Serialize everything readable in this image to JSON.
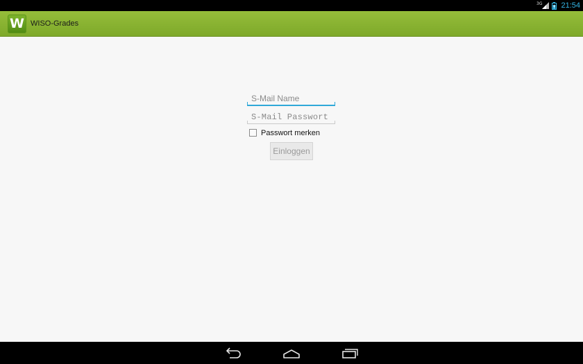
{
  "status_bar": {
    "network_label": "3G",
    "clock": "21:54",
    "accent_color": "#33b5e5"
  },
  "action_bar": {
    "icon_letter": "W",
    "title": "WISO-Grades",
    "color": "#8cb534"
  },
  "login_form": {
    "username": {
      "value": "",
      "placeholder": "S-Mail Name",
      "focused": true
    },
    "password": {
      "value": "",
      "placeholder": "S-Mail Passwort"
    },
    "remember": {
      "label": "Passwort merken",
      "checked": false
    },
    "submit": {
      "label": "Einloggen",
      "enabled": false
    }
  },
  "nav_bar": {
    "icons": [
      "back-icon",
      "home-icon",
      "recent-apps-icon"
    ]
  }
}
